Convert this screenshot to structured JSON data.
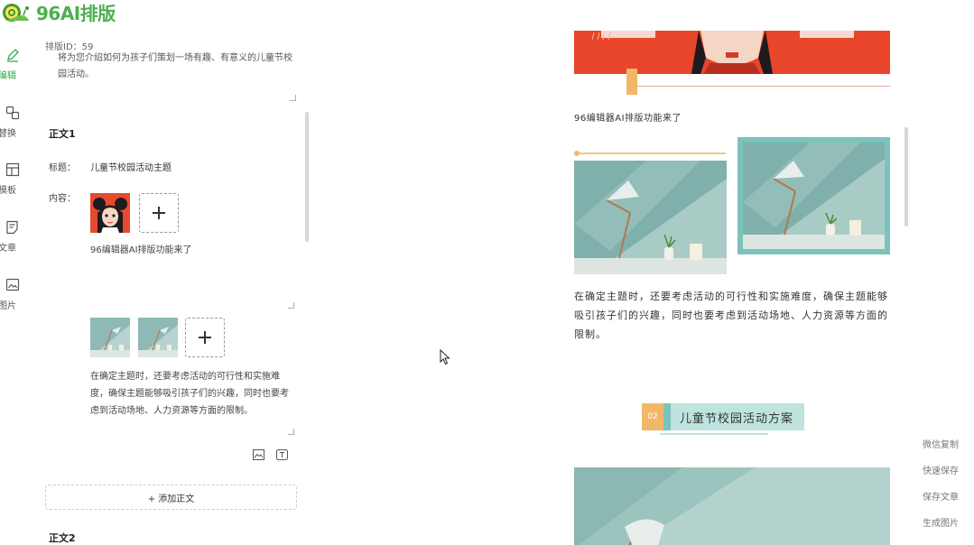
{
  "app": {
    "logo_text": "96AI排版"
  },
  "nav": {
    "items": [
      {
        "label": "容编辑",
        "icon": "pencil-icon",
        "active": true
      },
      {
        "label": "式替换",
        "icon": "swap-icon",
        "active": false
      },
      {
        "label": "个模板",
        "icon": "template-icon",
        "active": false
      },
      {
        "label": "的文章",
        "icon": "article-icon",
        "active": false
      },
      {
        "label": "的图片",
        "icon": "image-icon",
        "active": false
      }
    ]
  },
  "editor": {
    "sort_id": "排版ID：59",
    "intro_text": "将为您介绍如何为孩子们策划一场有趣、有意义的儿童节校园活动。",
    "section1": {
      "title": "正文1",
      "title_label": "标题：",
      "title_value": "儿童节校园活动主题",
      "content_label": "内容：",
      "caption": "96编辑器AI排版功能来了",
      "body": "在确定主题时，还要考虑活动的可行性和实施难度，确保主题能够吸引孩子们的兴趣，同时也要考虑到活动场地、人力资源等方面的限制。"
    },
    "add_body_label": "+ 添加正文",
    "section2": {
      "title": "正文2"
    }
  },
  "preview": {
    "caption": "96编辑器AI排版功能来了",
    "paragraph": "在确定主题时，还要考虑活动的可行性和实施难度，确保主题能够吸引孩子们的兴趣，同时也要考虑到活动场地、人力资源等方面的限制。",
    "heading_number": "02",
    "heading_text": "儿童节校园活动方案"
  },
  "rail": {
    "wechat_copy": "微信复制",
    "quick_save": "快速保存",
    "save_article": "保存文章",
    "generate_image": "生成图片"
  },
  "colors": {
    "brand_green": "#4caf50",
    "banner_red": "#e8452a",
    "accent_gold": "#f0b866",
    "teal": "#7cc2bd"
  }
}
